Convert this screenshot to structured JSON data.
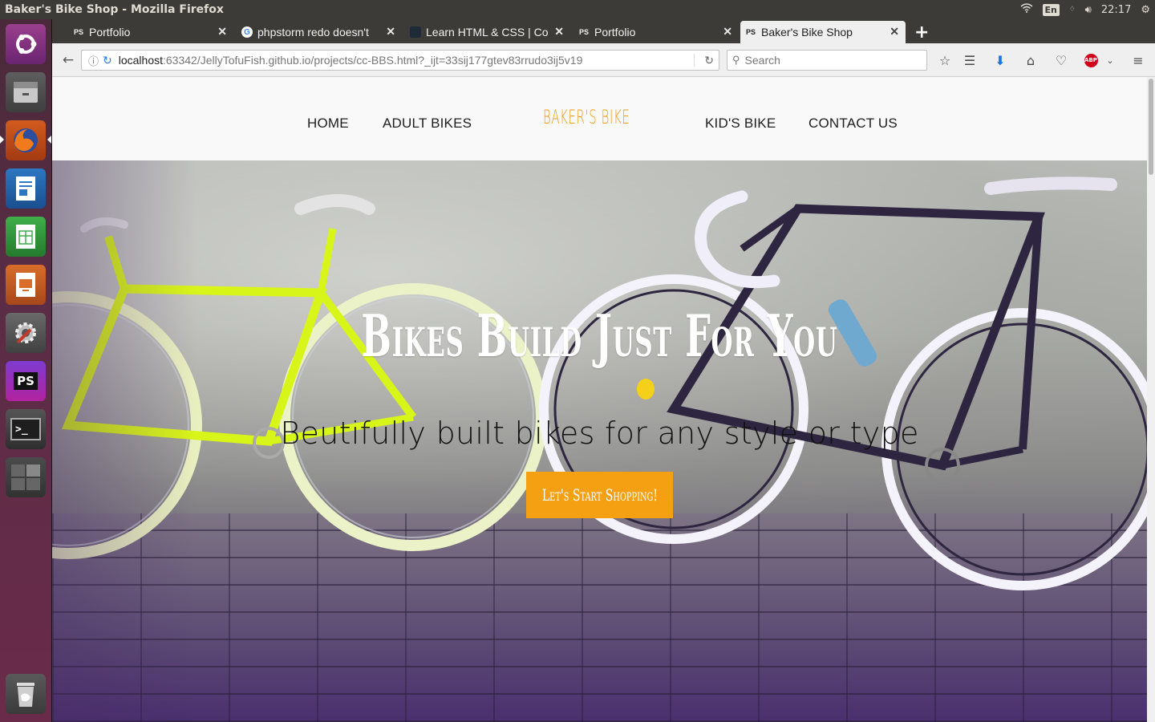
{
  "os": {
    "window_title": "Baker's Bike Shop - Mozilla Firefox",
    "keyboard_layout": "En",
    "clock": "22:17"
  },
  "launcher": {
    "items": [
      {
        "name": "ubuntu-dash",
        "icon": "ubuntu-logo-icon"
      },
      {
        "name": "files",
        "icon": "file-cabinet-icon"
      },
      {
        "name": "firefox",
        "icon": "firefox-icon"
      },
      {
        "name": "libreoffice-writer",
        "icon": "writer-icon"
      },
      {
        "name": "libreoffice-calc",
        "icon": "calc-icon"
      },
      {
        "name": "libreoffice-impress",
        "icon": "impress-icon"
      },
      {
        "name": "system-settings",
        "icon": "settings-icon"
      },
      {
        "name": "phpstorm",
        "icon": "phpstorm-icon",
        "label": "PS"
      },
      {
        "name": "terminal",
        "icon": "terminal-icon",
        "label": ">_"
      },
      {
        "name": "workspaces",
        "icon": "workspaces-icon"
      },
      {
        "name": "trash",
        "icon": "trash-icon"
      }
    ]
  },
  "browser": {
    "tabs": [
      {
        "label": "Portfolio",
        "favicon": "PS",
        "active": false
      },
      {
        "label": "phpstorm redo doesn't",
        "favicon": "G",
        "active": false
      },
      {
        "label": "Learn HTML & CSS | Co",
        "favicon": "",
        "active": false
      },
      {
        "label": "Portfolio",
        "favicon": "PS",
        "active": false
      },
      {
        "label": "Baker's Bike Shop",
        "favicon": "PS",
        "active": true
      }
    ],
    "url_host": "localhost",
    "url_rest": ":63342/JellyTofuFish.github.io/projects/cc-BBS.html?_ijt=33sij177gtev83rrudo3ij5v19",
    "search_placeholder": "Search"
  },
  "site": {
    "nav": {
      "home": "HOME",
      "adult_bikes": "ADULT BIKES",
      "brand": "BAKER'S BIKE",
      "kids_bike": "KID'S BIKE",
      "contact_us": "CONTACT US"
    },
    "hero": {
      "title": "Bikes Build Just For You",
      "subtitle": "Beutifully built bikes for any style or type",
      "cta": "Let's Start Shopping!"
    },
    "colors": {
      "accent": "#f5a012",
      "brand": "#f39c12",
      "hero_title": "#ffffff",
      "hero_subtitle": "#121212",
      "yellow_bike": "#d8f51a",
      "dark_bike": "#2e2640"
    }
  }
}
